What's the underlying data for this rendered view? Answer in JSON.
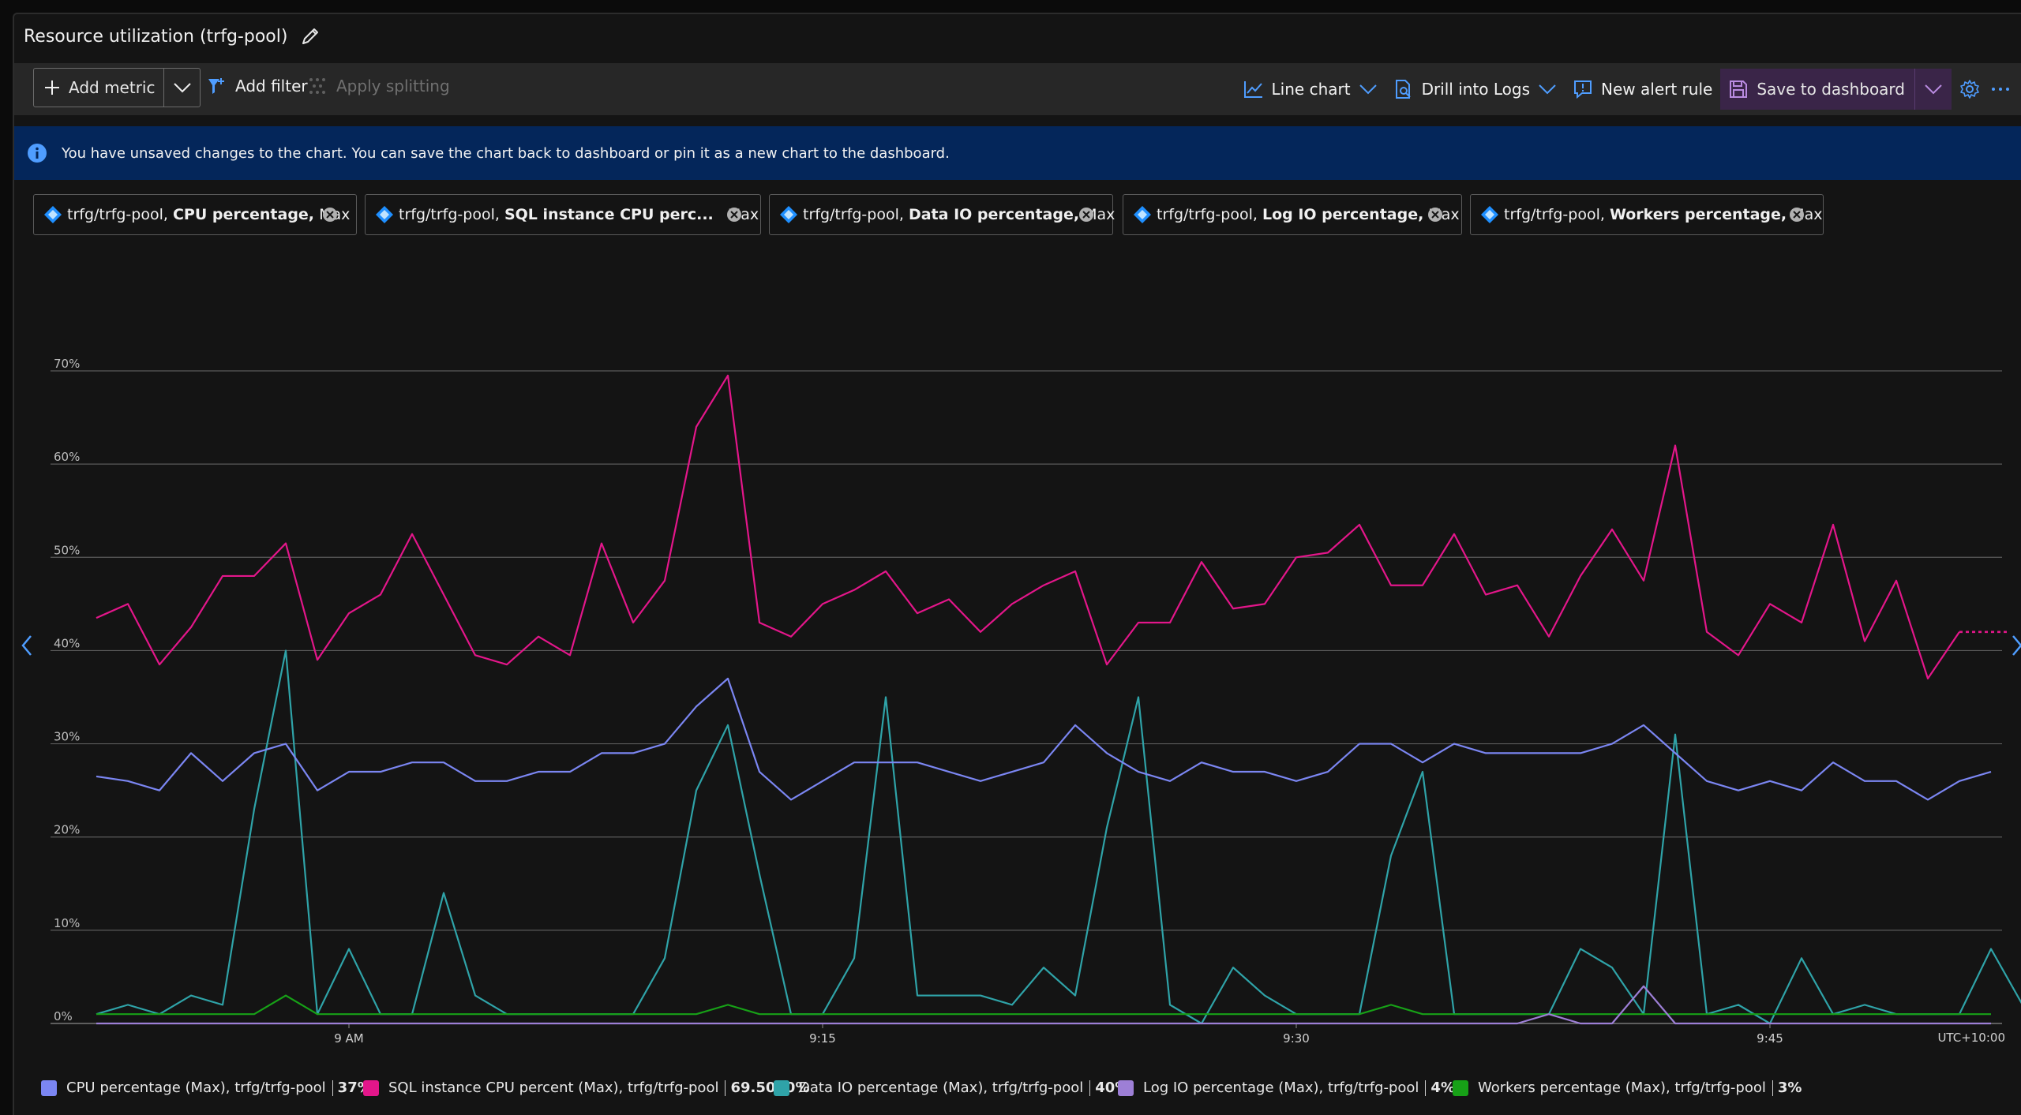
{
  "title": "Resource utilization (trfg-pool)",
  "toolbar": {
    "add_metric": "Add metric",
    "add_filter": "Add filter",
    "apply_splitting": "Apply splitting",
    "line_chart": "Line chart",
    "drill_logs": "Drill into Logs",
    "new_alert": "New alert rule",
    "save_dashboard": "Save to dashboard"
  },
  "info": {
    "message": "You have unsaved changes to the chart. You can save the chart back to dashboard or pin it as a new chart to the dashboard."
  },
  "pills": [
    {
      "resource": "trfg/trfg-pool,",
      "metric": "CPU percentage,",
      "agg": "Max"
    },
    {
      "resource": "trfg/trfg-pool,",
      "metric": "SQL instance CPU perc...",
      "agg": "Max"
    },
    {
      "resource": "trfg/trfg-pool,",
      "metric": "Data IO percentage,",
      "agg": "Max"
    },
    {
      "resource": "trfg/trfg-pool,",
      "metric": "Log IO percentage,",
      "agg": "Max"
    },
    {
      "resource": "trfg/trfg-pool,",
      "metric": "Workers percentage,",
      "agg": "Max"
    }
  ],
  "colors": {
    "cpu": "#7b86f2",
    "sql": "#e3168a",
    "dataio": "#2fa3a8",
    "logio": "#9d7fd6",
    "workers": "#17a117",
    "accent": "#4f9dff"
  },
  "chart_data": {
    "type": "line",
    "ylim": [
      0,
      70
    ],
    "y_ticks": [
      "0%",
      "10%",
      "20%",
      "30%",
      "40%",
      "50%",
      "60%",
      "70%"
    ],
    "x_tick_labels": [
      "9 AM",
      "9:15",
      "9:30",
      "9:45"
    ],
    "x_tick_index": [
      8,
      23,
      38,
      53
    ],
    "timezone_label": "UTC+10:00",
    "series": [
      {
        "name": "CPU percentage (Max), trfg/trfg-pool",
        "key": "cpu",
        "summary": "37%",
        "values": [
          26.5,
          26,
          25,
          29,
          26,
          29,
          30,
          25,
          27,
          27,
          28,
          28,
          26,
          26,
          27,
          27,
          29,
          29,
          30,
          34,
          37,
          27,
          24,
          26,
          28,
          28,
          28,
          27,
          26,
          27,
          28,
          32,
          29,
          27,
          26,
          28,
          27,
          27,
          26,
          27,
          30,
          30,
          28,
          30,
          29,
          29,
          29,
          29,
          30,
          32,
          29,
          26,
          25,
          26,
          25,
          28,
          26,
          26,
          24,
          26,
          27
        ]
      },
      {
        "name": "SQL instance CPU percent (Max), trfg/trfg-pool",
        "key": "sql",
        "summary": "69.5000%",
        "values": [
          43.5,
          45,
          38.5,
          42.5,
          48,
          48,
          51.5,
          39,
          44,
          46,
          52.5,
          46,
          39.5,
          38.5,
          41.5,
          39.5,
          51.5,
          43,
          47.5,
          64,
          69.5,
          43,
          41.5,
          45,
          46.5,
          48.5,
          44,
          45.5,
          42,
          45,
          47,
          48.5,
          38.5,
          43,
          43,
          49.5,
          44.5,
          45,
          50,
          50.5,
          53.5,
          47,
          47,
          52.5,
          46,
          47,
          41.5,
          48,
          53,
          47.5,
          62,
          42,
          39.5,
          45,
          43,
          53.5,
          41,
          47.5,
          37,
          42,
          42
        ]
      },
      {
        "name": "Data IO percentage (Max), trfg/trfg-pool",
        "key": "dataio",
        "summary": "40%",
        "values": [
          1,
          2,
          1,
          3,
          2,
          23,
          40,
          1,
          8,
          1,
          1,
          14,
          3,
          1,
          1,
          1,
          1,
          1,
          7,
          25,
          32,
          16,
          1,
          1,
          7,
          35,
          3,
          3,
          3,
          2,
          6,
          3,
          21,
          35,
          2,
          0,
          6,
          3,
          1,
          1,
          1,
          18,
          27,
          1,
          1,
          1,
          1,
          8,
          6,
          1,
          31,
          1,
          2,
          0,
          7,
          1,
          2,
          1,
          1,
          1,
          8,
          2
        ]
      },
      {
        "name": "Log IO percentage (Max), trfg/trfg-pool",
        "key": "logio",
        "summary": "4%",
        "values": [
          0,
          0,
          0,
          0,
          0,
          0,
          0,
          0,
          0,
          0,
          0,
          0,
          0,
          0,
          0,
          0,
          0,
          0,
          0,
          0,
          0,
          0,
          0,
          0,
          0,
          0,
          0,
          0,
          0,
          0,
          0,
          0,
          0,
          0,
          0,
          0,
          0,
          0,
          0,
          0,
          0,
          0,
          0,
          0,
          0,
          0,
          1,
          0,
          0,
          4,
          0,
          0,
          0,
          0,
          0,
          0,
          0,
          0,
          0,
          0,
          0
        ]
      },
      {
        "name": "Workers percentage (Max), trfg/trfg-pool",
        "key": "workers",
        "summary": "3%",
        "values": [
          1,
          1,
          1,
          1,
          1,
          1,
          3,
          1,
          1,
          1,
          1,
          1,
          1,
          1,
          1,
          1,
          1,
          1,
          1,
          1,
          2,
          1,
          1,
          1,
          1,
          1,
          1,
          1,
          1,
          1,
          1,
          1,
          1,
          1,
          1,
          1,
          1,
          1,
          1,
          1,
          1,
          2,
          1,
          1,
          1,
          1,
          1,
          1,
          1,
          1,
          1,
          1,
          1,
          1,
          1,
          1,
          1,
          1,
          1,
          1,
          1
        ]
      }
    ]
  }
}
